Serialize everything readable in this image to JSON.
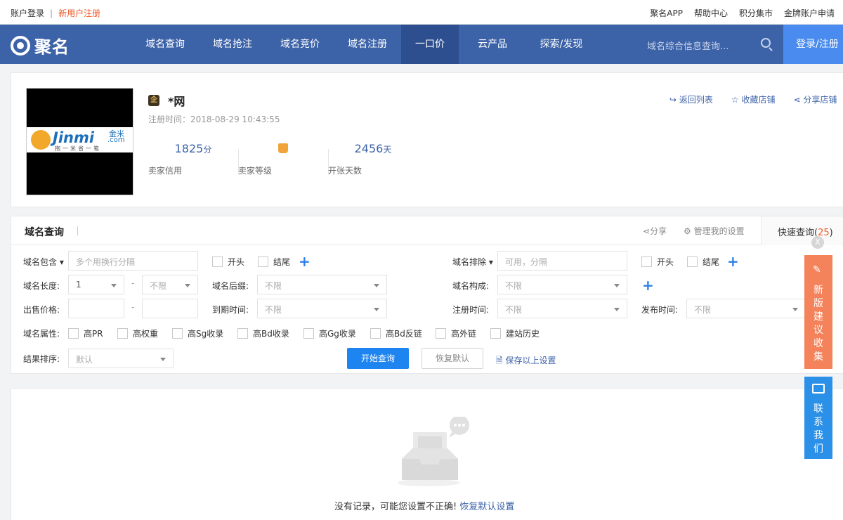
{
  "topbar": {
    "login": "账户登录",
    "separator": "|",
    "register": "新用户注册",
    "links": [
      "聚名APP",
      "帮助中心",
      "积分集市",
      "金牌账户申请"
    ]
  },
  "nav": {
    "logo_text": "聚名",
    "items": [
      "域名查询",
      "域名抢注",
      "域名竞价",
      "域名注册",
      "一口价",
      "云产品",
      "探索/发现"
    ],
    "active_item": "一口价",
    "search_placeholder": "域名综合信息查询...",
    "login_button": "登录/注册"
  },
  "shop": {
    "logo": {
      "brand": "Jinmi",
      "cn": "金米",
      "domain": ".com",
      "slogan": "抱一米省一笔"
    },
    "name": "*网",
    "badge": "企",
    "reg_time": "注册时间：2018-08-29 10:43:55",
    "stats": [
      {
        "value": "1825",
        "unit": "分",
        "label": "卖家信用"
      },
      {
        "value": "",
        "unit": "",
        "label": "卖家等级"
      },
      {
        "value": "2456",
        "unit": "天",
        "label": "开张天数"
      }
    ],
    "links": [
      "返回列表",
      "收藏店铺",
      "分享店铺"
    ]
  },
  "query": {
    "title": "域名查询",
    "share": "分享",
    "manage": "管理我的设置",
    "quick_label": "快速查询(",
    "quick_count": "25",
    "quick_close": ")",
    "contains_label": "域名包含",
    "contains_placeholder": "多个用换行分隔",
    "start": "开头",
    "end": "结尾",
    "exclude_label": "域名排除",
    "exclude_placeholder": "可用，分隔",
    "length_label": "域名长度:",
    "length_min": "1",
    "length_max": "不限",
    "suffix_label": "域名后缀:",
    "suffix_value": "不限",
    "compose_label": "域名构成:",
    "compose_value": "不限",
    "price_label": "出售价格:",
    "expire_label": "到期时间:",
    "expire_value": "不限",
    "regtime_label": "注册时间:",
    "regtime_value": "不限",
    "publish_label": "发布时间:",
    "publish_value": "不限",
    "attr_label": "域名属性:",
    "attrs": [
      "高PR",
      "高权重",
      "高Sg收录",
      "高Bd收录",
      "高Gg收录",
      "高Bd反链",
      "高外链",
      "建站历史"
    ],
    "sort_label": "结果排序:",
    "sort_value": "默认",
    "search_button": "开始查询",
    "reset_button": "恢复默认",
    "save_link": "保存以上设置"
  },
  "results": {
    "empty_text": "没有记录，可能您设置不正确!",
    "reset_link": "恢复默认设置"
  },
  "side": {
    "close": "X",
    "feedback": [
      "新",
      "版",
      "建",
      "议",
      "收",
      "集"
    ],
    "contact": [
      "联",
      "系",
      "我",
      "们"
    ]
  }
}
